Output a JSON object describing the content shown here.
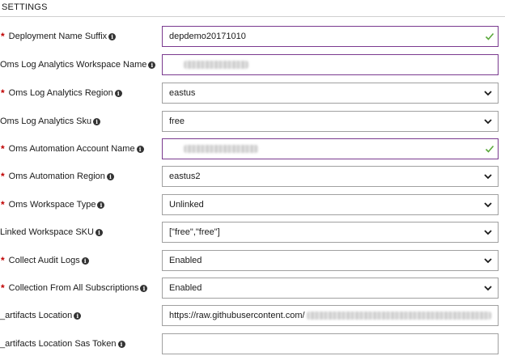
{
  "section": {
    "title": "SETTINGS"
  },
  "fields": [
    {
      "label": "Deployment Name Suffix",
      "required": true,
      "type": "text",
      "value": "depdemo20171010",
      "state": "valid"
    },
    {
      "label": "Oms Log Analytics Workspace Name",
      "required": false,
      "type": "text",
      "value": "",
      "state": "redacted"
    },
    {
      "label": "Oms Log Analytics Region",
      "required": true,
      "type": "select",
      "value": "eastus"
    },
    {
      "label": "Oms Log Analytics Sku",
      "required": false,
      "type": "select",
      "value": "free"
    },
    {
      "label": "Oms Automation Account Name",
      "required": true,
      "type": "text",
      "value": "",
      "state": "valid-redacted"
    },
    {
      "label": "Oms Automation Region",
      "required": true,
      "type": "select",
      "value": "eastus2"
    },
    {
      "label": "Oms Workspace Type",
      "required": true,
      "type": "select",
      "value": "Unlinked"
    },
    {
      "label": "Linked Workspace SKU",
      "required": false,
      "type": "select",
      "value": "[\"free\",\"free\"]"
    },
    {
      "label": "Collect Audit Logs",
      "required": true,
      "type": "select",
      "value": "Enabled"
    },
    {
      "label": "Collection From All Subscriptions",
      "required": true,
      "type": "select",
      "value": "Enabled"
    },
    {
      "label": "_artifacts Location",
      "required": false,
      "type": "text",
      "value": "https://raw.githubusercontent.com/",
      "state": "partially-redacted"
    },
    {
      "label": "_artifacts Location Sas Token",
      "required": false,
      "type": "text",
      "value": ""
    }
  ],
  "icons": {
    "info": "info-icon",
    "chevron": "chevron-down-icon",
    "valid": "checkmark-icon"
  },
  "colors": {
    "required": "#c00000",
    "focus_border": "#7a3a8f",
    "valid_check": "#5aa83a"
  }
}
